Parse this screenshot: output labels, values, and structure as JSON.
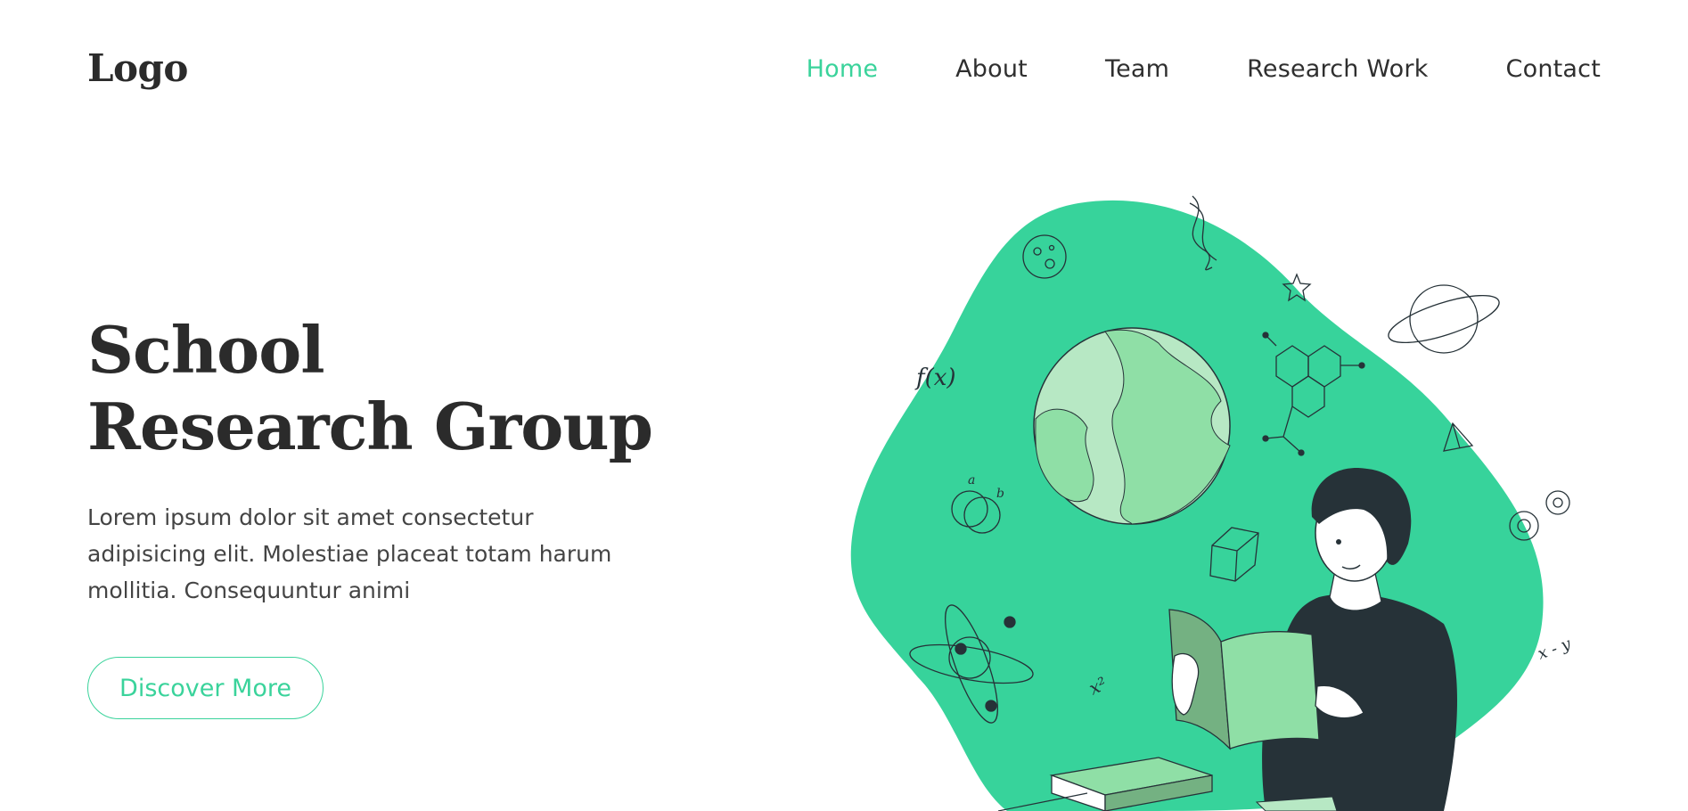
{
  "header": {
    "logo": "Logo",
    "nav": [
      {
        "label": "Home",
        "active": true
      },
      {
        "label": "About",
        "active": false
      },
      {
        "label": "Team",
        "active": false
      },
      {
        "label": "Research Work",
        "active": false
      },
      {
        "label": "Contact",
        "active": false
      }
    ]
  },
  "hero": {
    "title": "School Research Group",
    "description": "Lorem ipsum dolor sit amet consectetur adipisicing elit. Molestiae placeat totam harum mollitia. Consequuntur animi",
    "button_label": "Discover More"
  },
  "illustration": {
    "formula_fx": "f(x)",
    "formula_x2": "x²",
    "formula_xy": "x - y",
    "label_a": "a",
    "label_b": "b"
  },
  "colors": {
    "accent": "#3ad39b",
    "text": "#2f2f2f",
    "blob": "#37d39b",
    "globe_light": "#b7e8c4",
    "globe_dark": "#8fdfa6",
    "shirt": "#263238"
  }
}
